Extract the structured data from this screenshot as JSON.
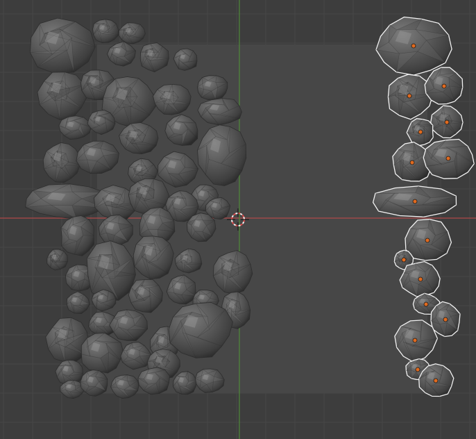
{
  "viewport": {
    "name": "3d-viewport",
    "background": "#3d3d3d",
    "grid_color": "#474747",
    "x_axis_color": "#b04a4a",
    "y_axis_color": "#4f8a3a",
    "plane_color": "#474747",
    "rock_base_color": "#555555",
    "selection_outline_color": "#f2f2f2",
    "origin_color": "#e06a1f"
  },
  "objects": {
    "unselected_group": "rock-cluster",
    "selected_group": "selected-rock-column",
    "selected_count": 16
  },
  "cursor": {
    "name": "3d-cursor-icon"
  }
}
